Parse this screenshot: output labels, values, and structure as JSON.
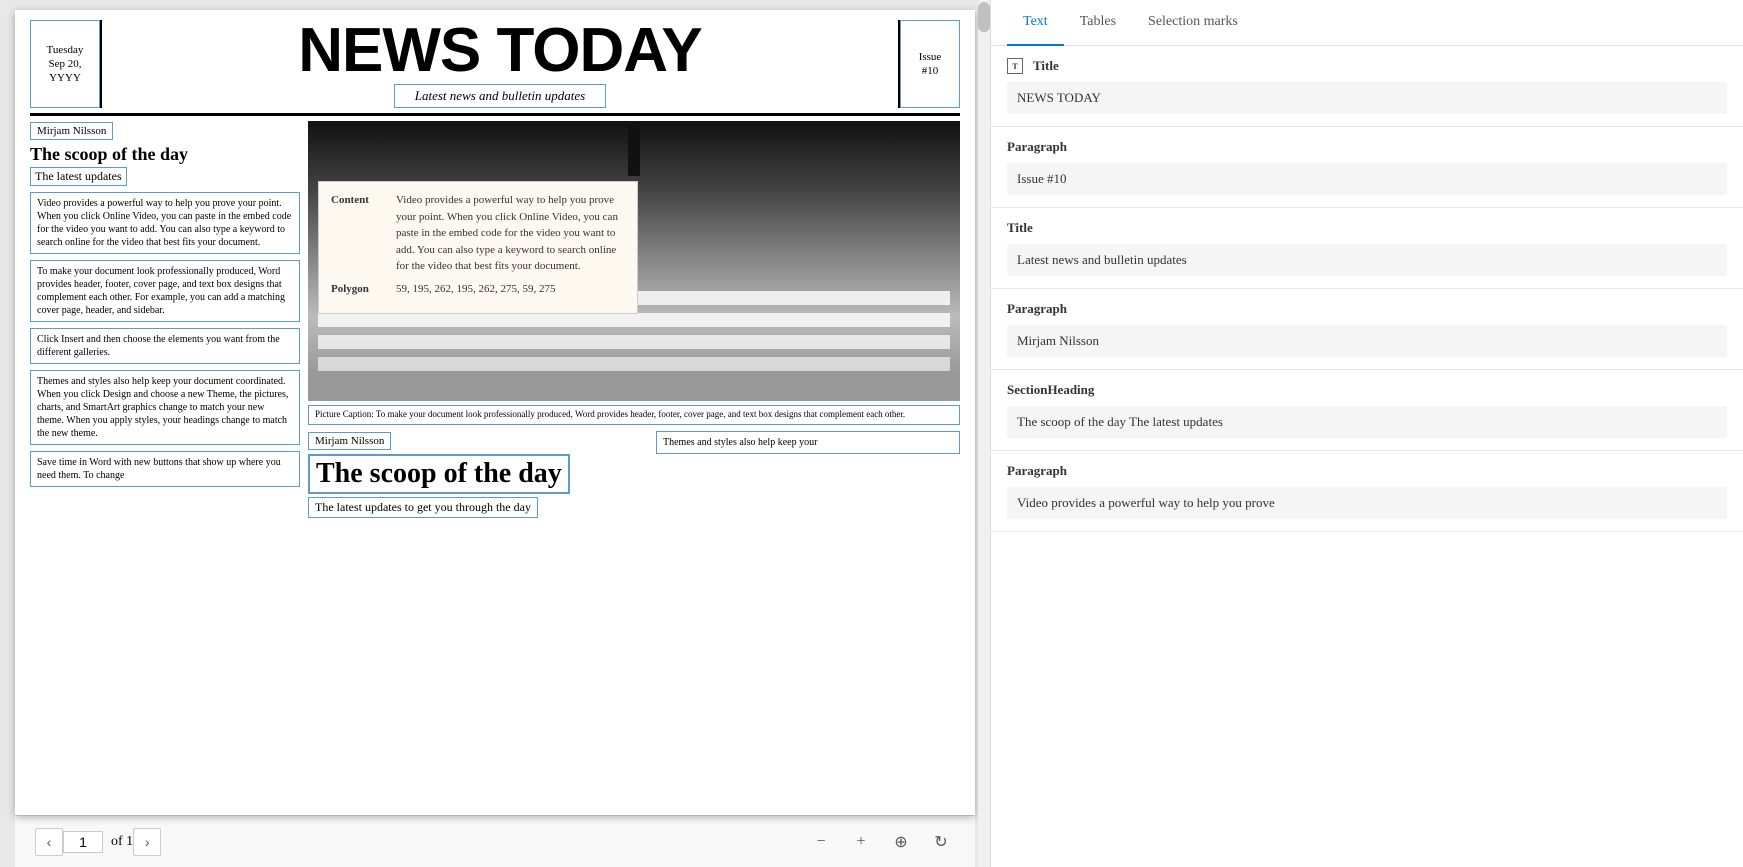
{
  "tabs": {
    "text": "Text",
    "tables": "Tables",
    "selectionMarks": "Selection marks"
  },
  "newspaper": {
    "date": "Tuesday\nSep 20,\nYYYY",
    "title": "NEWS TODAY",
    "subtitle": "Latest news and bulletin updates",
    "issue": "Issue\n#10",
    "author1": "Mirjam Nilsson",
    "sectionHeading1": "The scoop of the day",
    "sectionSubheading1": "The latest updates",
    "textBlock1": "Video provides a powerful way to help you prove your point. When you click Online Video, you can paste in the embed code for the video you want to add. You can also type a keyword to search online for the video that best fits your document.",
    "textBlock2": "To make your document look professionally produced, Word provides header, footer, cover page, and text box designs that complement each other. For example, you can add a matching cover page, header, and sidebar.",
    "textBlock3": "Click Insert and then choose the elements you want from the different galleries.",
    "textBlock4": "Themes and styles also help keep your document coordinated. When you click Design and choose a new Theme, the pictures, charts, and SmartArt graphics change to match your new theme. When you apply styles, your headings change to match the new theme.",
    "textBlock5": "Save time in Word with new buttons that show up where you need them. To change",
    "tooltipLabel1": "Content",
    "tooltipContent1": "Video provides a powerful way to help you prove your point. When you click Online Video, you can paste in the embed code for the video you want to add. You can also type a keyword to search online for the video that best fits your document.",
    "tooltipLabel2": "Polygon",
    "tooltipContent2": "59, 195, 262, 195, 262, 275, 59, 275",
    "caption": "Picture Caption: To make your document look professionally produced, Word provides header, footer, cover page, and text box designs that complement each other.",
    "author2": "Mirjam Nilsson",
    "sectionHeading2": "The scoop of the day",
    "sectionSubheading2": "The latest updates to get you through the day",
    "textBlock6": "Themes and styles also help keep your"
  },
  "pagination": {
    "currentPage": "1",
    "ofText": "of 1"
  },
  "rightPanel": {
    "sections": [
      {
        "type": "Title",
        "value": "NEWS TODAY"
      },
      {
        "type": "Paragraph",
        "value": "Issue #10"
      },
      {
        "type": "Title",
        "value": "Latest news and bulletin updates"
      },
      {
        "type": "Paragraph",
        "value": "Mirjam Nilsson"
      },
      {
        "type": "SectionHeading",
        "value": "The scoop of the day The latest updates"
      },
      {
        "type": "Paragraph",
        "value": "Video provides a powerful way to help you prove"
      }
    ]
  }
}
